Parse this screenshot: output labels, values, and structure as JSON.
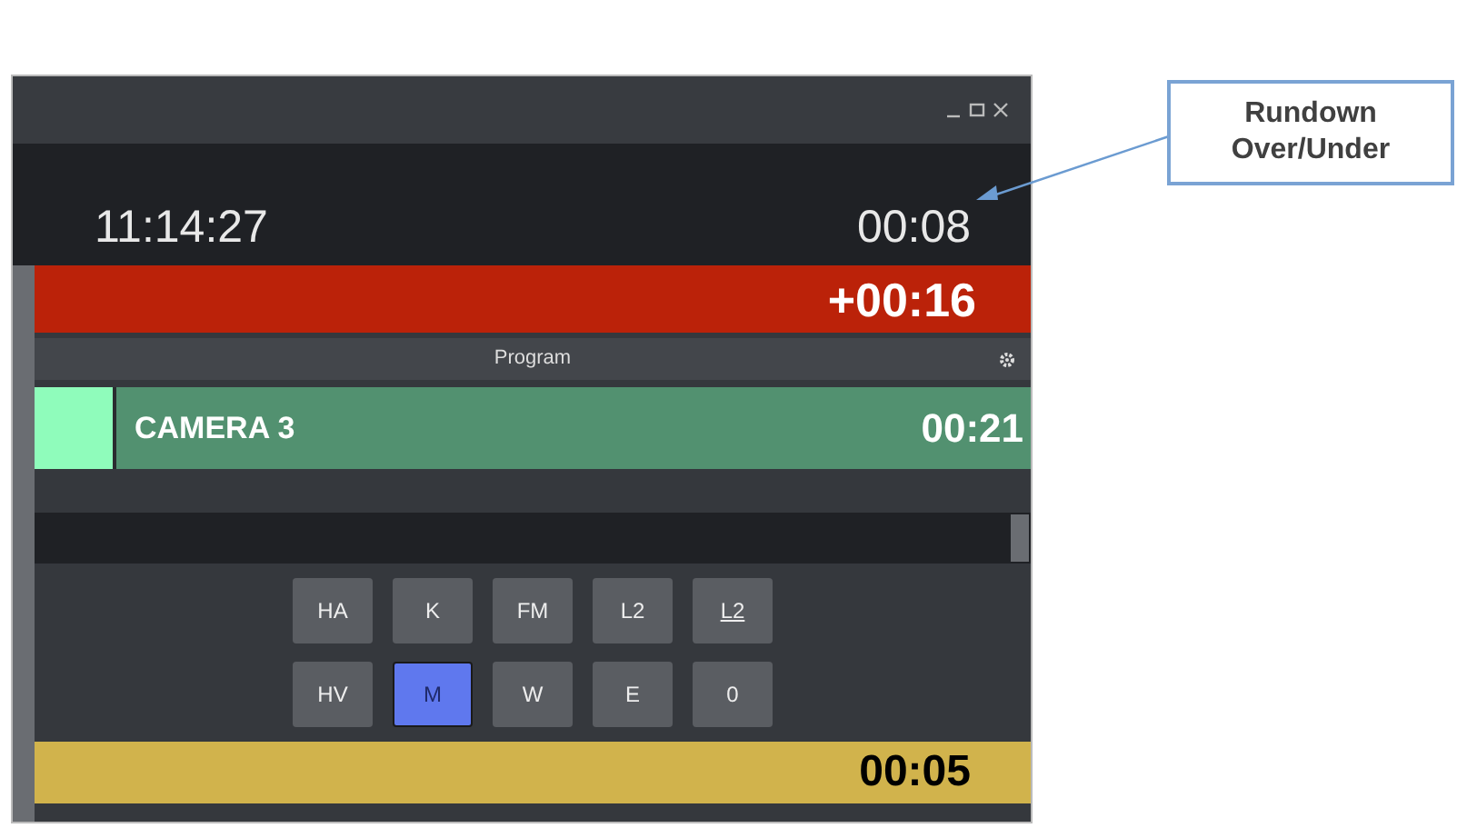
{
  "clock": {
    "time": "11:14:27",
    "over_under": "00:08"
  },
  "over_under_bar": {
    "value": "+00:16"
  },
  "program": {
    "title": "Program",
    "source": "CAMERA 3",
    "duration": "00:21"
  },
  "buttons": [
    {
      "label": "HA",
      "selected": false,
      "underlined": false
    },
    {
      "label": "K",
      "selected": false,
      "underlined": false
    },
    {
      "label": "FM",
      "selected": false,
      "underlined": false
    },
    {
      "label": "L2",
      "selected": false,
      "underlined": false
    },
    {
      "label": "L2",
      "selected": false,
      "underlined": true
    },
    {
      "label": "HV",
      "selected": false,
      "underlined": false
    },
    {
      "label": "M",
      "selected": true,
      "underlined": false
    },
    {
      "label": "W",
      "selected": false,
      "underlined": false
    },
    {
      "label": "E",
      "selected": false,
      "underlined": false
    },
    {
      "label": "0",
      "selected": false,
      "underlined": false
    }
  ],
  "countdown": {
    "value": "00:05"
  },
  "callout": {
    "text": "Rundown Over/Under"
  }
}
